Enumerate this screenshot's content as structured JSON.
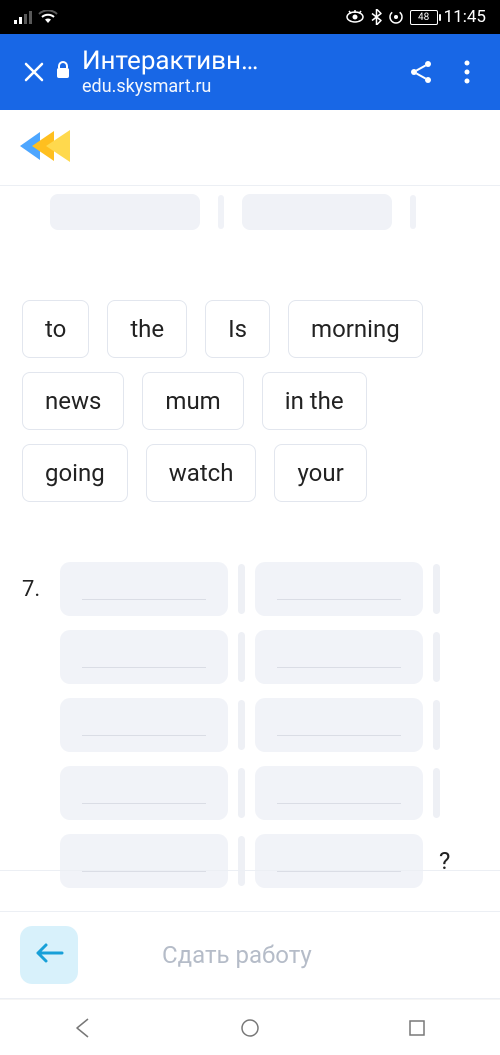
{
  "status": {
    "time": "11:45",
    "battery_pct": "48"
  },
  "browser": {
    "title": "Интерактивн…",
    "host": "edu.skysmart.ru"
  },
  "words": {
    "w0": "to",
    "w1": "the",
    "w2": "Is",
    "w3": "morning",
    "w4": "news",
    "w5": "mum",
    "w6": "in the",
    "w7": "going",
    "w8": "watch",
    "w9": "your"
  },
  "question": {
    "number": "7.",
    "end": "?"
  },
  "footer": {
    "submit": "Сдать работу"
  }
}
